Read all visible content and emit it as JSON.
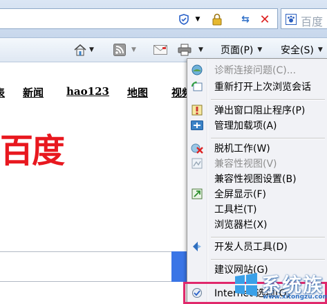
{
  "toolbar": {
    "page_label": "页面(P)",
    "safety_label": "安全(S)"
  },
  "search": {
    "value": "百度"
  },
  "page": {
    "nav": [
      "表",
      "新闻",
      "hao123",
      "地图",
      "视频"
    ],
    "logo_text": "百度"
  },
  "tools_menu": {
    "items": [
      {
        "label": "诊断连接问题(C)...",
        "enabled": false,
        "icon": "diagnose-icon"
      },
      {
        "label": "重新打开上次浏览会话",
        "enabled": true,
        "icon": "reopen-session-icon"
      },
      {
        "label": "弹出窗口阻止程序(P)",
        "enabled": true,
        "icon": "popup-blocker-icon"
      },
      {
        "label": "管理加载项(A)",
        "enabled": true,
        "icon": "addons-icon"
      },
      {
        "label": "脱机工作(W)",
        "enabled": true,
        "icon": "offline-icon"
      },
      {
        "label": "兼容性视图(V)",
        "enabled": false,
        "icon": "compat-view-icon"
      },
      {
        "label": "兼容性视图设置(B)",
        "enabled": true,
        "icon": ""
      },
      {
        "label": "全屏显示(F)",
        "enabled": true,
        "icon": "fullscreen-icon"
      },
      {
        "label": "工具栏(T)",
        "enabled": true,
        "icon": ""
      },
      {
        "label": "浏览器栏(X)",
        "enabled": true,
        "icon": ""
      },
      {
        "label": "开发人员工具(D)",
        "enabled": true,
        "icon": "dev-tools-icon"
      },
      {
        "label": "建议网站(G)",
        "enabled": true,
        "icon": ""
      },
      {
        "label": "Internet 选项(O)",
        "enabled": true,
        "icon": "internet-options-icon"
      }
    ]
  },
  "watermark": {
    "text": "系统族",
    "sub": "www.xitongzu.com"
  },
  "colors": {
    "highlight_border": "#e0286b",
    "logo_red": "#e8181f",
    "search_button": "#3a75e6"
  }
}
